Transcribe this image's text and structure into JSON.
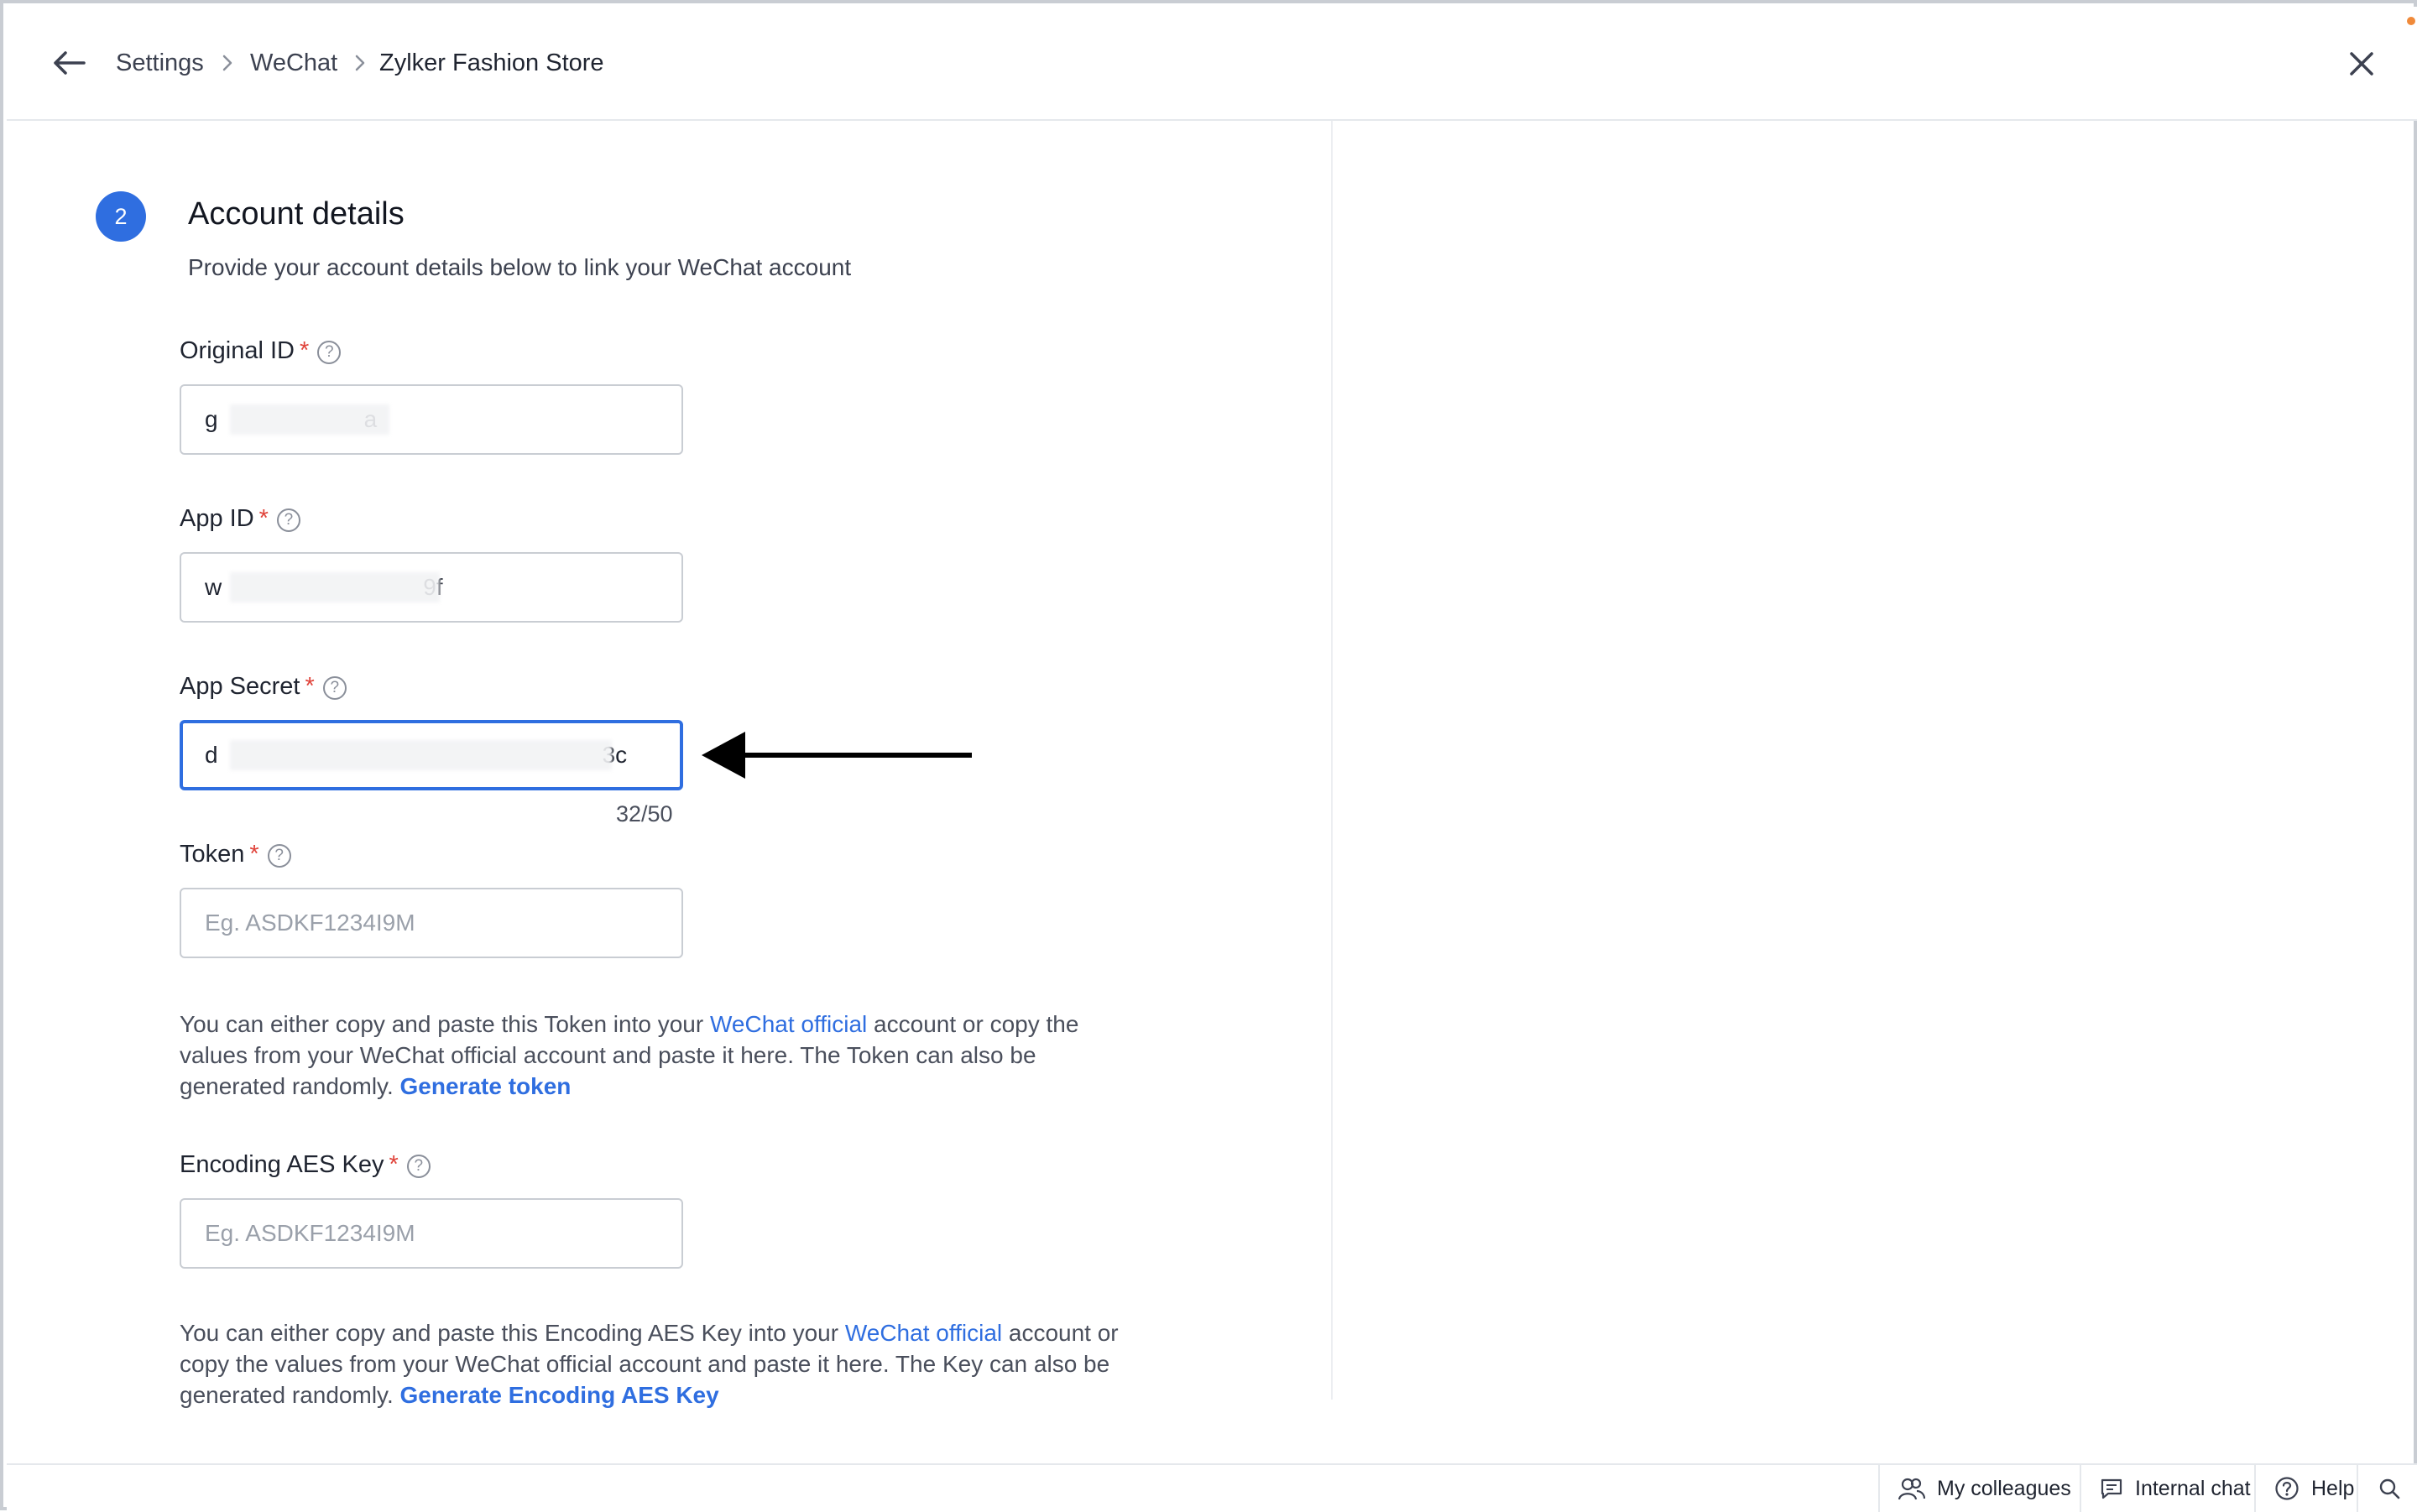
{
  "header": {
    "breadcrumb": [
      "Settings",
      "WeChat",
      "Zylker Fashion Store"
    ]
  },
  "step": {
    "number": "2",
    "title": "Account details",
    "description": "Provide your account details below to link your WeChat account"
  },
  "fields": {
    "original_id": {
      "label": "Original ID",
      "value_start": "g",
      "value_end": "a"
    },
    "app_id": {
      "label": "App ID",
      "value_start": "w",
      "value_end": "9f"
    },
    "app_secret": {
      "label": "App Secret",
      "value_start": "d",
      "value_end": "3c",
      "counter": "32/50"
    },
    "token": {
      "label": "Token",
      "placeholder": "Eg. ASDKF1234I9M"
    },
    "aes_key": {
      "label": "Encoding AES Key",
      "placeholder": "Eg. ASDKF1234I9M"
    }
  },
  "required_mark": "*",
  "help_glyph": "?",
  "token_note": {
    "before": "You can either copy and paste this Token into your ",
    "link": "WeChat official",
    "middle": " account or copy the values from your WeChat official account and paste it here. The Token can also be generated randomly. ",
    "action": "Generate token"
  },
  "aes_note": {
    "before": "You can either copy and paste this Encoding AES Key into your ",
    "link": "WeChat official",
    "middle": " account or copy the values from your WeChat official account and paste it here. The Key can also be generated randomly. ",
    "action": "Generate Encoding AES Key"
  },
  "footer": {
    "colleagues": "My colleagues",
    "chat": "Internal chat",
    "help": "Help"
  },
  "colors": {
    "accent": "#2f6ee0",
    "required": "#e0433a"
  }
}
